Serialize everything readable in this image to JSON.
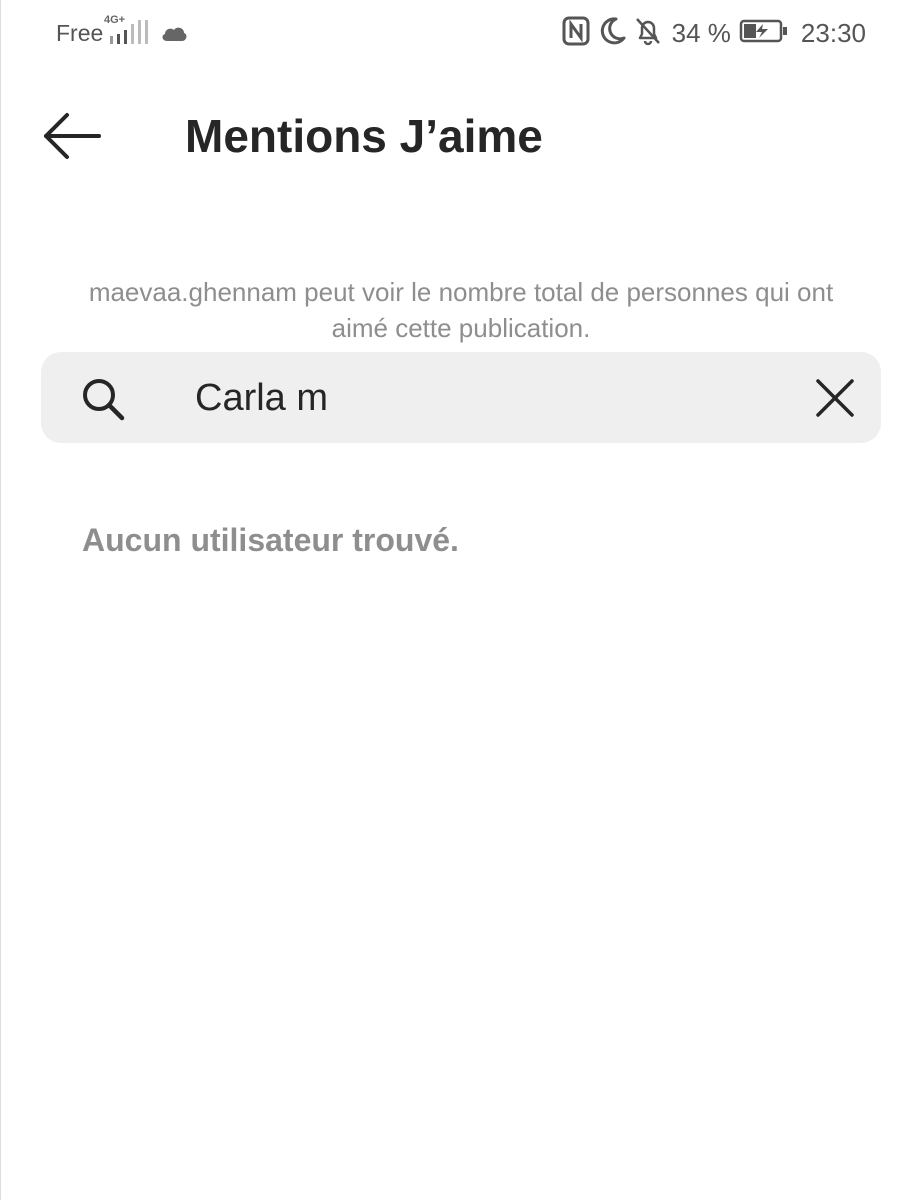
{
  "status_bar": {
    "carrier": "Free",
    "network_type": "4G+",
    "battery_percent": "34 %",
    "time": "23:30",
    "icons": [
      "signal-icon",
      "cloud-icon",
      "nfc-icon",
      "moon-icon",
      "bell-off-icon",
      "battery-charging-icon"
    ]
  },
  "header": {
    "title": "Mentions J’aime",
    "back_icon": "arrow-left-icon"
  },
  "info": {
    "text": "maevaa.ghennam peut voir le nombre total de personnes qui ont aimé cette publication."
  },
  "search": {
    "value": "Carla m",
    "search_icon": "search-icon",
    "clear_icon": "close-icon"
  },
  "results": {
    "empty_message": "Aucun utilisateur trouvé."
  },
  "colors": {
    "background": "#ffffff",
    "title_text": "#262626",
    "secondary_text": "#8e8e8e",
    "search_background": "#efefef"
  }
}
